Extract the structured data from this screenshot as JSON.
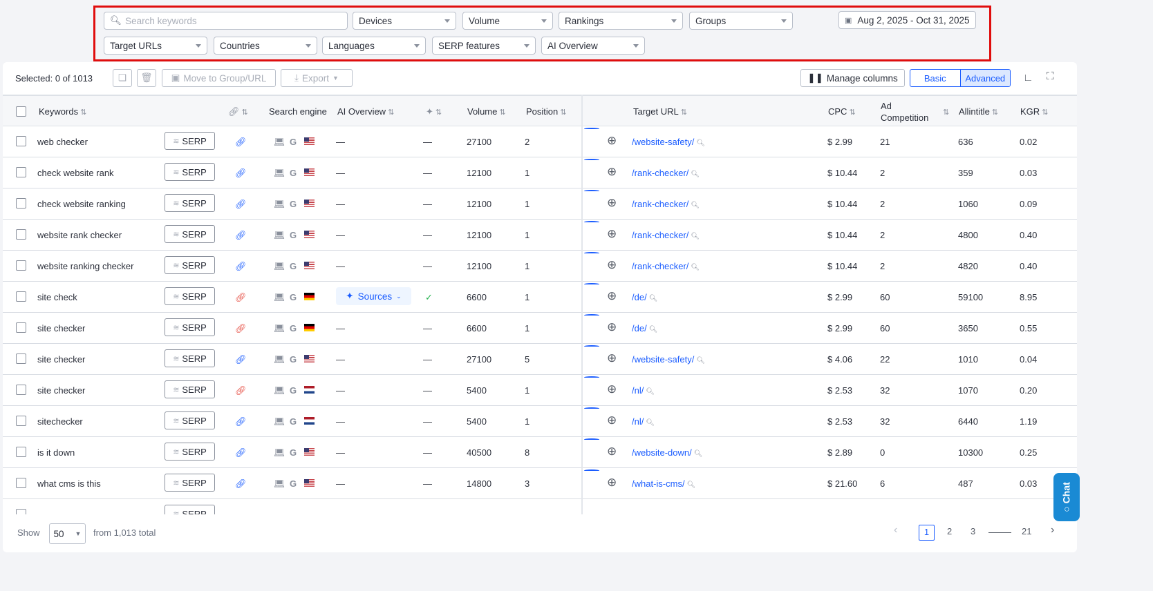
{
  "filters": {
    "search_placeholder": "Search keywords",
    "row1": [
      "Devices",
      "Volume",
      "Rankings",
      "Groups"
    ],
    "row2": [
      "Target URLs",
      "Countries",
      "Languages",
      "SERP features",
      "AI Overview"
    ],
    "date_range": "Aug 2, 2025 - Oct 31, 2025"
  },
  "toolbar": {
    "selected": "Selected: 0 of 1013",
    "move": "Move to Group/URL",
    "export": "Export",
    "manage_columns": "Manage columns",
    "basic": "Basic",
    "advanced": "Advanced"
  },
  "columns": {
    "keywords": "Keywords",
    "search_engine": "Search engine",
    "ai_overview": "AI Overview",
    "volume": "Volume",
    "position": "Position",
    "target_url": "Target URL",
    "cpc": "CPC",
    "ad_competition": "Ad Competition",
    "allintitle": "Allintitle",
    "kgr": "KGR"
  },
  "serp_label": "SERP",
  "sources_label": "Sources",
  "dash": "—",
  "colors": {
    "accent": "#1a5cff",
    "link_ok": "#1a5cff",
    "link_broken": "#e5483d",
    "check": "#22b14c",
    "highlight_border": "#e00d0d"
  },
  "rows": [
    {
      "kw": "web checker",
      "link": "ok",
      "flag": "us",
      "ai": "",
      "feat": "",
      "vol": "27100",
      "pos": "2",
      "url": "/website-safety/",
      "cpc": "$ 2.99",
      "ad": "21",
      "allin": "636",
      "kgr": "0.02"
    },
    {
      "kw": "check website rank",
      "link": "ok",
      "flag": "us",
      "ai": "",
      "feat": "",
      "vol": "12100",
      "pos": "1",
      "url": "/rank-checker/",
      "cpc": "$ 10.44",
      "ad": "2",
      "allin": "359",
      "kgr": "0.03"
    },
    {
      "kw": "check website ranking",
      "link": "ok",
      "flag": "us",
      "ai": "",
      "feat": "",
      "vol": "12100",
      "pos": "1",
      "url": "/rank-checker/",
      "cpc": "$ 10.44",
      "ad": "2",
      "allin": "1060",
      "kgr": "0.09"
    },
    {
      "kw": "website rank checker",
      "link": "ok",
      "flag": "us",
      "ai": "",
      "feat": "",
      "vol": "12100",
      "pos": "1",
      "url": "/rank-checker/",
      "cpc": "$ 10.44",
      "ad": "2",
      "allin": "4800",
      "kgr": "0.40"
    },
    {
      "kw": "website ranking checker",
      "link": "ok",
      "flag": "us",
      "ai": "",
      "feat": "",
      "vol": "12100",
      "pos": "1",
      "url": "/rank-checker/",
      "cpc": "$ 10.44",
      "ad": "2",
      "allin": "4820",
      "kgr": "0.40"
    },
    {
      "kw": "site check",
      "link": "broken",
      "flag": "de",
      "ai": "sources",
      "feat": "check",
      "vol": "6600",
      "pos": "1",
      "url": "/de/",
      "cpc": "$ 2.99",
      "ad": "60",
      "allin": "59100",
      "kgr": "8.95"
    },
    {
      "kw": "site checker",
      "link": "broken",
      "flag": "de",
      "ai": "",
      "feat": "",
      "vol": "6600",
      "pos": "1",
      "url": "/de/",
      "cpc": "$ 2.99",
      "ad": "60",
      "allin": "3650",
      "kgr": "0.55"
    },
    {
      "kw": "site checker",
      "link": "ok",
      "flag": "us",
      "ai": "",
      "feat": "",
      "vol": "27100",
      "pos": "5",
      "url": "/website-safety/",
      "cpc": "$ 4.06",
      "ad": "22",
      "allin": "1010",
      "kgr": "0.04"
    },
    {
      "kw": "site checker",
      "link": "broken",
      "flag": "nl",
      "ai": "",
      "feat": "",
      "vol": "5400",
      "pos": "1",
      "url": "/nl/",
      "cpc": "$ 2.53",
      "ad": "32",
      "allin": "1070",
      "kgr": "0.20"
    },
    {
      "kw": "sitechecker",
      "link": "ok",
      "flag": "nl",
      "ai": "",
      "feat": "",
      "vol": "5400",
      "pos": "1",
      "url": "/nl/",
      "cpc": "$ 2.53",
      "ad": "32",
      "allin": "6440",
      "kgr": "1.19"
    },
    {
      "kw": "is it down",
      "link": "ok",
      "flag": "us",
      "ai": "",
      "feat": "",
      "vol": "40500",
      "pos": "8",
      "url": "/website-down/",
      "cpc": "$ 2.89",
      "ad": "0",
      "allin": "10300",
      "kgr": "0.25"
    },
    {
      "kw": "what cms is this",
      "link": "ok",
      "flag": "us",
      "ai": "",
      "feat": "",
      "vol": "14800",
      "pos": "3",
      "url": "/what-is-cms/",
      "cpc": "$ 21.60",
      "ad": "6",
      "allin": "487",
      "kgr": "0.03"
    }
  ],
  "footer": {
    "show": "Show",
    "per_page": "50",
    "total": "from 1,013 total",
    "pages": [
      "1",
      "2",
      "3",
      "21"
    ]
  },
  "chat": "Chat"
}
